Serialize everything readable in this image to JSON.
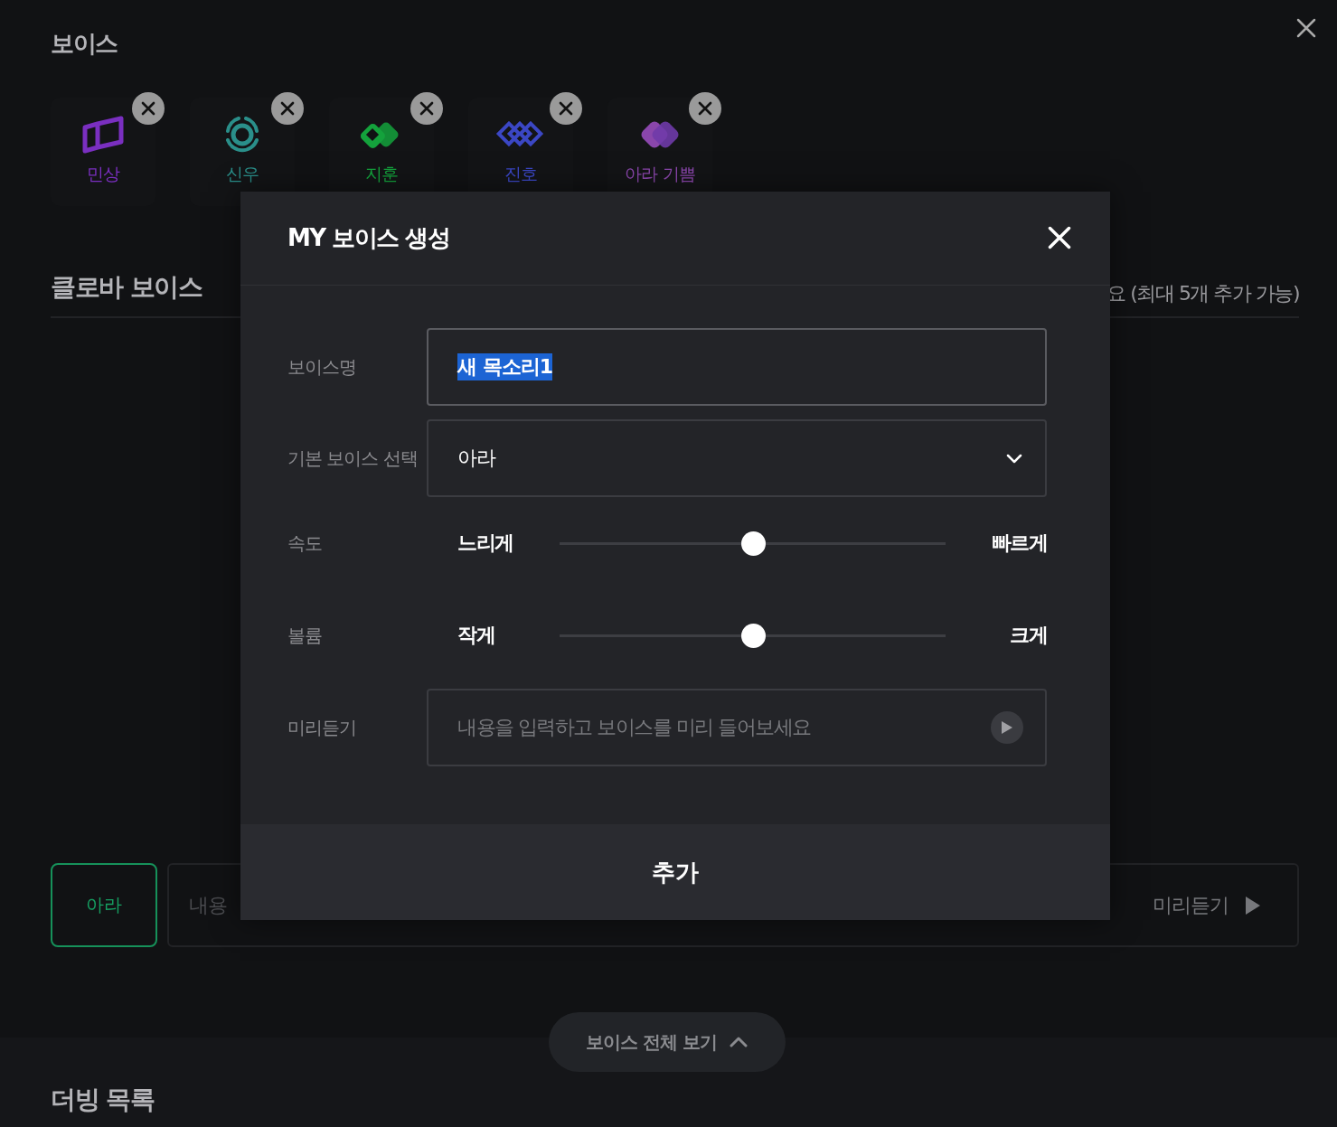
{
  "page": {
    "title": "보이스"
  },
  "my_voices": [
    {
      "name": "민상",
      "color": "#7a2fc0"
    },
    {
      "name": "신우",
      "color": "#2a8f8a"
    },
    {
      "name": "지훈",
      "color": "#14a23c"
    },
    {
      "name": "진호",
      "color": "#3b47c4"
    },
    {
      "name": "아라 기쁨",
      "color": "#8a46ab"
    }
  ],
  "clova_voice": {
    "title": "클로바 보이스",
    "hint": "요 (최대 5개 추가 가능)"
  },
  "composer": {
    "voice": "아라",
    "placeholder": "내용",
    "preview_button": "미리듣기"
  },
  "show_all_button": "보이스 전체 보기",
  "dubbing": {
    "title": "더빙 목록"
  },
  "dialog": {
    "title": "MY 보이스 생성",
    "name_label": "보이스명",
    "name_value": "새 목소리1",
    "name_value_selected": true,
    "base_label": "기본 보이스 선택",
    "base_value": "아라",
    "sliders": [
      {
        "label": "속도",
        "min_label": "느리게",
        "max_label": "빠르게",
        "level": 0.5
      },
      {
        "label": "볼륨",
        "min_label": "작게",
        "max_label": "크게",
        "level": 0.5
      }
    ],
    "preview_label": "미리듣기",
    "preview_placeholder": "내용을 입력하고 보이스를 미리 들어보세요",
    "submit": "추가"
  }
}
